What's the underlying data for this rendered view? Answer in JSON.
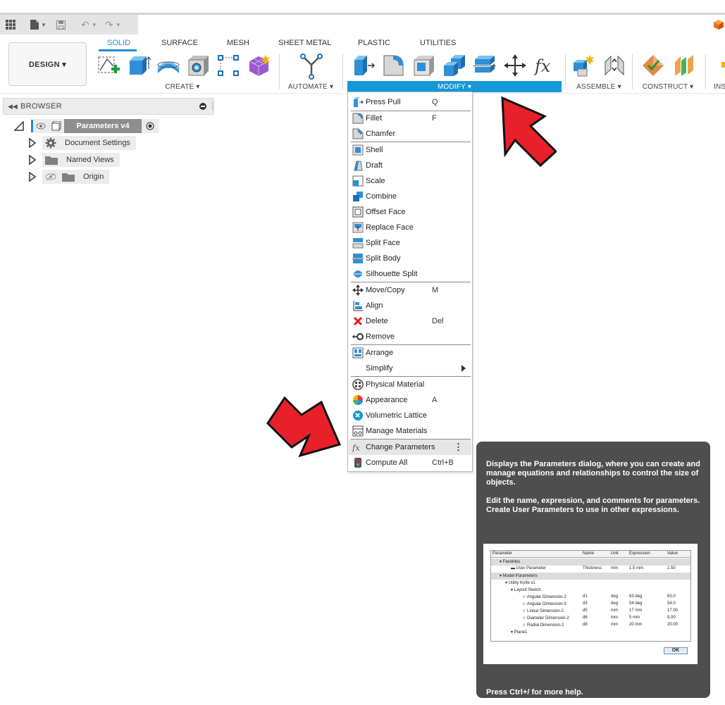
{
  "quick_access": {
    "grid_icon": "app-grid-icon",
    "file_icon": "file-icon",
    "save_icon": "save-icon",
    "undo_icon": "undo-icon",
    "redo_icon": "redo-icon"
  },
  "ribbon": {
    "workspace_label": "DESIGN ▾",
    "tabs": [
      {
        "label": "SOLID",
        "active": true
      },
      {
        "label": "SURFACE"
      },
      {
        "label": "MESH"
      },
      {
        "label": "SHEET METAL"
      },
      {
        "label": "PLASTIC"
      },
      {
        "label": "UTILITIES"
      }
    ],
    "groups": {
      "create": "CREATE ▾",
      "automate": "AUTOMATE ▾",
      "modify": "MODIFY ▾",
      "assemble": "ASSEMBLE ▾",
      "construct": "CONSTRUCT ▾",
      "inspect": "INS"
    },
    "accent_color": "#1697d8"
  },
  "browser": {
    "title": "BROWSER",
    "root": "Parameters v4",
    "items": [
      "Document Settings",
      "Named Views",
      "Origin"
    ]
  },
  "menu": {
    "items": [
      {
        "label": "Press Pull",
        "shortcut": "Q",
        "icon": "press-pull-icon"
      },
      {
        "label": "Fillet",
        "shortcut": "F",
        "icon": "fillet-icon"
      },
      {
        "label": "Chamfer",
        "shortcut": "",
        "icon": "chamfer-icon"
      },
      {
        "label": "Shell",
        "shortcut": "",
        "icon": "shell-icon"
      },
      {
        "label": "Draft",
        "shortcut": "",
        "icon": "draft-icon"
      },
      {
        "label": "Scale",
        "shortcut": "",
        "icon": "scale-icon"
      },
      {
        "label": "Combine",
        "shortcut": "",
        "icon": "combine-icon"
      },
      {
        "label": "Offset Face",
        "shortcut": "",
        "icon": "offset-face-icon"
      },
      {
        "label": "Replace Face",
        "shortcut": "",
        "icon": "replace-face-icon"
      },
      {
        "label": "Split Face",
        "shortcut": "",
        "icon": "split-face-icon"
      },
      {
        "label": "Split Body",
        "shortcut": "",
        "icon": "split-body-icon"
      },
      {
        "label": "Silhouette Split",
        "shortcut": "",
        "icon": "silhouette-split-icon"
      },
      {
        "label": "Move/Copy",
        "shortcut": "M",
        "icon": "move-icon"
      },
      {
        "label": "Align",
        "shortcut": "",
        "icon": "align-icon"
      },
      {
        "label": "Delete",
        "shortcut": "Del",
        "icon": "delete-icon"
      },
      {
        "label": "Remove",
        "shortcut": "",
        "icon": "remove-icon"
      },
      {
        "label": "Arrange",
        "shortcut": "",
        "icon": "arrange-icon"
      },
      {
        "label": "Simplify",
        "shortcut": "",
        "icon": "submenu-arrow-icon"
      },
      {
        "label": "Physical Material",
        "shortcut": "",
        "icon": "physical-material-icon"
      },
      {
        "label": "Appearance",
        "shortcut": "A",
        "icon": "appearance-icon"
      },
      {
        "label": "Volumetric Lattice",
        "shortcut": "",
        "icon": "volumetric-lattice-icon"
      },
      {
        "label": "Manage Materials",
        "shortcut": "",
        "icon": "manage-materials-icon"
      },
      {
        "label": "Change Parameters",
        "shortcut": "",
        "icon": "fx-icon"
      },
      {
        "label": "Compute All",
        "shortcut": "Ctrl+B",
        "icon": "compute-all-icon"
      }
    ]
  },
  "tooltip": {
    "p1": "Displays the Parameters dialog, where you can create and manage equations and relationships to control the size of objects.",
    "p2": "Edit the name, expression, and comments for parameters. Create User Parameters to use in other expressions.",
    "footer": "Press Ctrl+/ for more help.",
    "preview": {
      "headers": [
        "Parameter",
        "Name",
        "Unit",
        "Expression",
        "Value"
      ],
      "rows": [
        {
          "indent": 1,
          "label": "Favorites",
          "group": true,
          "cells": [
            "",
            "",
            "",
            ""
          ]
        },
        {
          "indent": 3,
          "label": "User Parameter",
          "cells": [
            "Thickness",
            "mm",
            "1.5 mm",
            "1.50"
          ]
        },
        {
          "indent": 1,
          "label": "Model Parameters",
          "group": true,
          "cells": [
            "",
            "",
            "",
            ""
          ]
        },
        {
          "indent": 2,
          "label": "Utility Knife v1",
          "cells": [
            "",
            "",
            "",
            ""
          ]
        },
        {
          "indent": 3,
          "label": "Layout Sketch",
          "cells": [
            "",
            "",
            "",
            ""
          ]
        },
        {
          "indent": 5,
          "label": "Angular Dimension-2",
          "cells": [
            "d1",
            "deg",
            "63 deg",
            "63.0"
          ]
        },
        {
          "indent": 5,
          "label": "Angular Dimension-3",
          "cells": [
            "d3",
            "deg",
            "54 deg",
            "54.0"
          ]
        },
        {
          "indent": 5,
          "label": "Linear Dimension-2",
          "cells": [
            "d5",
            "mm",
            "17 mm",
            "17.00"
          ]
        },
        {
          "indent": 5,
          "label": "Diameter Dimension-2",
          "cells": [
            "d6",
            "mm",
            "5 mm",
            "5.00"
          ]
        },
        {
          "indent": 5,
          "label": "Radial Dimension-2",
          "cells": [
            "d8",
            "mm",
            "20 mm",
            "20.00"
          ]
        },
        {
          "indent": 3,
          "label": "Plane1",
          "cells": [
            "",
            "",
            "",
            ""
          ]
        }
      ],
      "ok": "OK"
    }
  },
  "colors": {
    "tooltip_bg": "#4e4e4e",
    "highlight_arrow": "#e8202a"
  }
}
